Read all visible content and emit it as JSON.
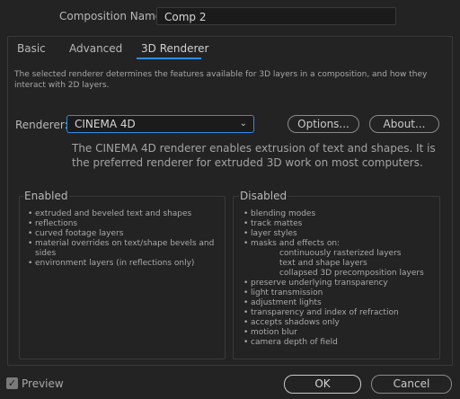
{
  "composition_name": {
    "label": "Composition Name:",
    "value": "Comp 2"
  },
  "tabs": [
    {
      "label": "Basic"
    },
    {
      "label": "Advanced"
    },
    {
      "label": "3D Renderer"
    }
  ],
  "description": "The selected renderer determines the features available for 3D layers in a composition, and how they interact with 2D layers.",
  "renderer": {
    "label": "Renderer:",
    "selected": "CINEMA 4D",
    "options_button": "Options...",
    "about_button": "About...",
    "info": "The CINEMA 4D renderer enables extrusion of text and shapes. It is the preferred renderer for extruded 3D work on most computers."
  },
  "enabled": {
    "title": "Enabled",
    "items": [
      "extruded and beveled text and shapes",
      "reflections",
      "curved footage layers",
      "material overrides on text/shape bevels and sides",
      "environment layers (in reflections only)"
    ]
  },
  "disabled": {
    "title": "Disabled",
    "items": [
      "blending modes",
      "track mattes",
      "layer styles",
      "masks and effects on:"
    ],
    "sub_items": [
      "continuously rasterized layers",
      "text and shape layers",
      "collapsed 3D precomposition layers"
    ],
    "items_after": [
      "preserve underlying transparency",
      "light transmission",
      "adjustment lights",
      "transparency and index of refraction",
      "accepts shadows only",
      "motion blur",
      "camera depth of field"
    ]
  },
  "footer": {
    "preview_label": "Preview",
    "ok_button": "OK",
    "cancel_button": "Cancel"
  },
  "colors": {
    "accent": "#2d8ceb",
    "background": "#232323"
  }
}
